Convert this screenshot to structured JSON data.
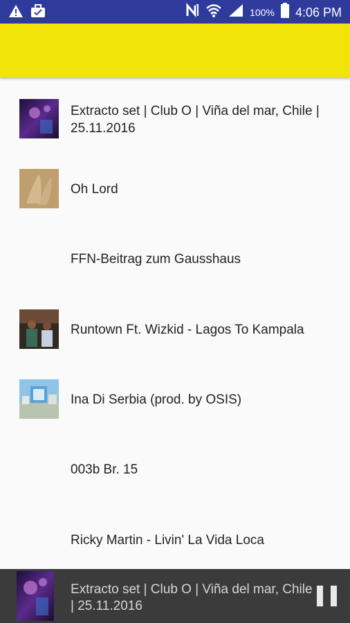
{
  "status_bar": {
    "battery": "100%",
    "time": "4:06 PM"
  },
  "list": {
    "items": [
      {
        "title": "Extracto set | Club O | Viña del mar, Chile | 25.11.2016",
        "has_thumb": true
      },
      {
        "title": "Oh Lord",
        "has_thumb": true
      },
      {
        "title": "FFN-Beitrag zum Gausshaus",
        "has_thumb": false
      },
      {
        "title": "Runtown Ft. Wizkid - Lagos To Kampala",
        "has_thumb": true
      },
      {
        "title": "Ina Di Serbia (prod. by OSIS)",
        "has_thumb": true
      },
      {
        "title": "003b Br. 15",
        "has_thumb": false
      },
      {
        "title": "Ricky Martin - Livin' La Vida Loca",
        "has_thumb": false
      }
    ]
  },
  "player": {
    "title": "Extracto set | Club O | Viña del mar, Chile | 25.11.2016",
    "state": "playing"
  },
  "colors": {
    "status_bar": "#2e3b9d",
    "toolbar": "#f2e409",
    "player_bg": "#3b3b3b"
  }
}
